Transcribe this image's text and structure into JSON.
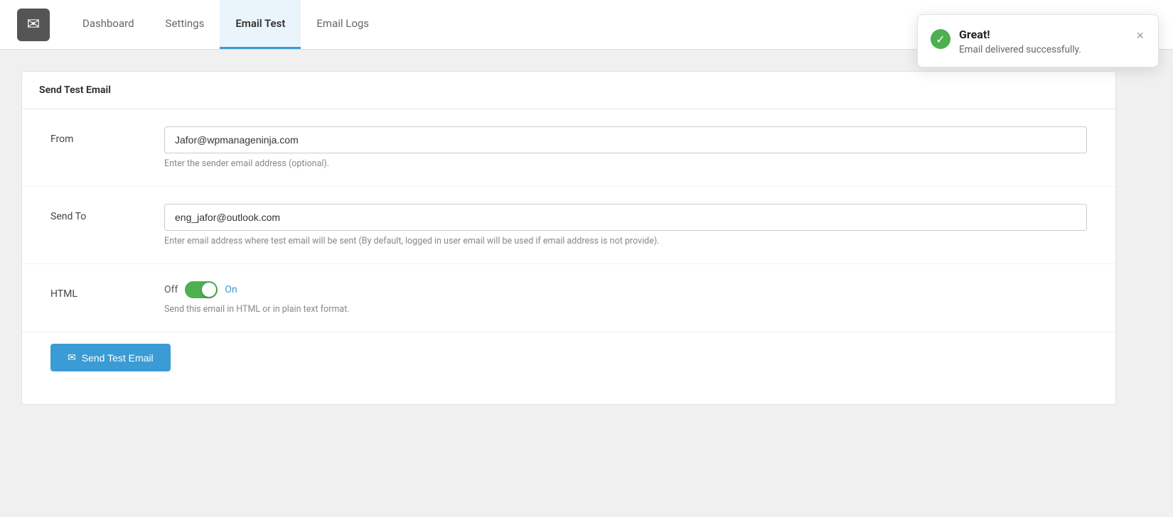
{
  "nav": {
    "logo_icon": "✉",
    "tabs": [
      {
        "id": "dashboard",
        "label": "Dashboard",
        "active": false
      },
      {
        "id": "settings",
        "label": "Settings",
        "active": false
      },
      {
        "id": "email-test",
        "label": "Email Test",
        "active": true
      },
      {
        "id": "email-logs",
        "label": "Email Logs",
        "active": false
      }
    ]
  },
  "card": {
    "header_title": "Send Test Email",
    "form": {
      "from_label": "From",
      "from_value": "Jafor@wpmanageninja.com",
      "from_hint": "Enter the sender email address (optional).",
      "send_to_label": "Send To",
      "send_to_value": "eng_jafor@outlook.com",
      "send_to_hint": "Enter email address where test email will be sent (By default, logged in user email will be used if email address is not provide).",
      "html_label": "HTML",
      "html_toggle_off": "Off",
      "html_toggle_on": "On",
      "html_hint": "Send this email in HTML or in plain text format.",
      "send_button_label": "Send Test Email"
    }
  },
  "toast": {
    "title": "Great!",
    "message": "Email delivered successfully.",
    "close_label": "×"
  }
}
